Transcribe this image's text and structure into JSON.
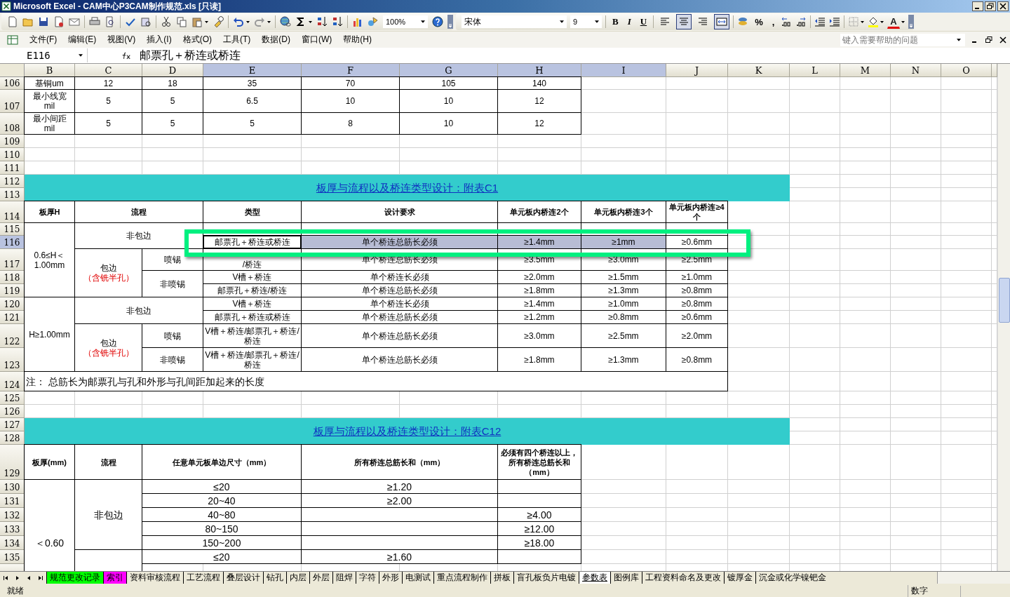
{
  "window": {
    "title": "Microsoft Excel - CAM中心P3CAM制作规范.xls [只读]"
  },
  "standard_toolbar": {
    "zoom": "100%"
  },
  "formatting_toolbar": {
    "font": "宋体",
    "size": "9",
    "styles": [
      {
        "label": "B",
        "on": false
      },
      {
        "label": "I",
        "on": false
      },
      {
        "label": "U",
        "on": false
      }
    ],
    "alignment": [
      {
        "pressed": false
      },
      {
        "pressed": true
      },
      {
        "pressed": false
      }
    ],
    "merge": true,
    "percent": "%",
    "comma": ",",
    "font_color": "A"
  },
  "menu": {
    "items": [
      "文件(F)",
      "编辑(E)",
      "视图(V)",
      "插入(I)",
      "格式(O)",
      "工具(T)",
      "数据(D)",
      "窗口(W)",
      "帮助(H)"
    ]
  },
  "help_box": {
    "placeholder": "键入需要帮助的问题"
  },
  "formula_bar": {
    "name_box": "E116",
    "formula": "邮票孔＋桥连或桥连"
  },
  "columns": [
    {
      "label": "B",
      "selected": false
    },
    {
      "label": "C",
      "selected": false
    },
    {
      "label": "D",
      "selected": false
    },
    {
      "label": "E",
      "selected": true
    },
    {
      "label": "F",
      "selected": true
    },
    {
      "label": "G",
      "selected": true
    },
    {
      "label": "H",
      "selected": true
    },
    {
      "label": "I",
      "selected": true
    },
    {
      "label": "J",
      "selected": false
    },
    {
      "label": "K",
      "selected": false
    },
    {
      "label": "L",
      "selected": false
    },
    {
      "label": "M",
      "selected": false
    },
    {
      "label": "N",
      "selected": false
    },
    {
      "label": "O",
      "selected": false
    }
  ],
  "rows": [
    {
      "label": "106",
      "selected": false
    },
    {
      "label": "107",
      "selected": false
    },
    {
      "label": "108",
      "selected": false
    },
    {
      "label": "109",
      "selected": false
    },
    {
      "label": "110",
      "selected": false
    },
    {
      "label": "111",
      "selected": false
    },
    {
      "label": "112",
      "selected": false
    },
    {
      "label": "113",
      "selected": false
    },
    {
      "label": "114",
      "selected": false
    },
    {
      "label": "115",
      "selected": false
    },
    {
      "label": "116",
      "selected": true
    },
    {
      "label": "117",
      "selected": false
    },
    {
      "label": "118",
      "selected": false
    },
    {
      "label": "119",
      "selected": false
    },
    {
      "label": "120",
      "selected": false
    },
    {
      "label": "121",
      "selected": false
    },
    {
      "label": "122",
      "selected": false
    },
    {
      "label": "123",
      "selected": false
    },
    {
      "label": "124",
      "selected": false
    },
    {
      "label": "125",
      "selected": false
    },
    {
      "label": "126",
      "selected": false
    },
    {
      "label": "127",
      "selected": false
    },
    {
      "label": "128",
      "selected": false
    },
    {
      "label": "129",
      "selected": false
    },
    {
      "label": "130",
      "selected": false
    },
    {
      "label": "131",
      "selected": false
    },
    {
      "label": "132",
      "selected": false
    },
    {
      "label": "133",
      "selected": false
    },
    {
      "label": "134",
      "selected": false
    },
    {
      "label": "135",
      "selected": false
    }
  ],
  "table_a": {
    "rows": [
      [
        "基铜um",
        "12",
        "18",
        "35",
        "70",
        "105",
        "140"
      ],
      [
        "最小线宽\nmil",
        "5",
        "5",
        "6.5",
        "10",
        "10",
        "12"
      ],
      [
        "最小间距\nmil",
        "5",
        "5",
        "5",
        "8",
        "10",
        "12"
      ]
    ]
  },
  "band_c1": {
    "title": "板厚与流程以及桥连类型设计：附表C1"
  },
  "table_c1": {
    "header": [
      "板厚H",
      "流程",
      "类型",
      "设计要求",
      "单元板内桥连2个",
      "单元板内桥连3个",
      "单元板内桥连≥4个"
    ],
    "cells": [
      {
        "text": "0.6≤H＜1.00mm"
      },
      {
        "text": "非包边"
      },
      {
        "text": "邮票孔＋桥连或桥连"
      },
      {
        "text": "单个桥连总筋长必须"
      },
      {
        "text": "≥1.4mm"
      },
      {
        "text": "≥1mm"
      },
      {
        "text": "≥0.6mm"
      },
      {
        "text": "包边",
        "note": "（含铣半孔）"
      },
      {
        "text": "喷锡"
      },
      {
        "text": "/桥连"
      },
      {
        "text": "单个桥连总筋长必须"
      },
      {
        "text": "≥3.5mm"
      },
      {
        "text": "≥3.0mm"
      },
      {
        "text": "≥2.5mm"
      },
      {
        "text": "非喷锡"
      },
      {
        "text": "V槽＋桥连"
      },
      {
        "text": "单个桥连长必须"
      },
      {
        "text": "≥2.0mm"
      },
      {
        "text": "≥1.5mm"
      },
      {
        "text": "≥1.0mm"
      },
      {
        "text": "邮票孔＋桥连/桥连"
      },
      {
        "text": "单个桥连总筋长必须"
      },
      {
        "text": "≥1.8mm"
      },
      {
        "text": "≥1.3mm"
      },
      {
        "text": "≥0.8mm"
      },
      {
        "text": "H≥1.00mm"
      },
      {
        "text": "非包边"
      },
      {
        "text": "V槽＋桥连"
      },
      {
        "text": "单个桥连长必须"
      },
      {
        "text": "≥1.4mm"
      },
      {
        "text": "≥1.0mm"
      },
      {
        "text": "≥0.8mm"
      },
      {
        "text": "邮票孔＋桥连或桥连"
      },
      {
        "text": "单个桥连总筋长必须"
      },
      {
        "text": "≥1.2mm"
      },
      {
        "text": "≥0.8mm"
      },
      {
        "text": "≥0.6mm"
      },
      {
        "text": "包边",
        "note": "（含铣半孔）"
      },
      {
        "text": "喷锡"
      },
      {
        "text": "V槽＋桥连/邮票孔＋桥连/桥连"
      },
      {
        "text": "单个桥连总筋长必须"
      },
      {
        "text": "≥3.0mm"
      },
      {
        "text": "≥2.5mm"
      },
      {
        "text": "≥2.0mm"
      },
      {
        "text": "非喷锡"
      },
      {
        "text": "V槽＋桥连/邮票孔＋桥连/桥连"
      },
      {
        "text": "单个桥连总筋长必须"
      },
      {
        "text": "≥1.8mm"
      },
      {
        "text": "≥1.3mm"
      },
      {
        "text": "≥0.8mm"
      }
    ]
  },
  "note": "注：  总筋长为邮票孔与孔和外形与孔间距加起来的长度",
  "band_c12": {
    "title": "板厚与流程以及桥连类型设计：附表C12"
  },
  "table_c12": {
    "header": [
      "板厚(mm)",
      "流程",
      "任意单元板单边尺寸（mm）",
      "所有桥连总筋长和（mm）",
      "必须有四个桥连以上，所有桥连总筋长和（mm）"
    ],
    "thickness": "＜0.60",
    "groups": [
      {
        "flow": "非包边",
        "rows": [
          {
            "size": "≤20",
            "total": "≥1.20"
          },
          {
            "size": "20~40",
            "total": "≥2.00"
          },
          {
            "size": "40~80",
            "four_plus": "≥4.00"
          },
          {
            "size": "80~150",
            "four_plus": "≥12.00"
          },
          {
            "size": "150~200",
            "four_plus": "≥18.00"
          }
        ]
      },
      {
        "rows": [
          {
            "size": "≤20",
            "total": "≥1.60"
          }
        ]
      }
    ]
  },
  "sheet_tabs": [
    {
      "label": "规范更改记录",
      "selected": false,
      "color": "#00ff00"
    },
    {
      "label": "索引",
      "selected": false,
      "color": "#ff00ff"
    },
    {
      "label": "资料审核流程",
      "selected": false
    },
    {
      "label": "工艺流程",
      "selected": false
    },
    {
      "label": "叠层设计",
      "selected": false
    },
    {
      "label": "钻孔",
      "selected": false
    },
    {
      "label": "内层",
      "selected": false
    },
    {
      "label": "外层",
      "selected": false
    },
    {
      "label": "阻焊",
      "selected": false
    },
    {
      "label": "字符",
      "selected": false
    },
    {
      "label": "外形",
      "selected": false
    },
    {
      "label": "电测试",
      "selected": false
    },
    {
      "label": "重点流程制作",
      "selected": false
    },
    {
      "label": "拼板",
      "selected": false
    },
    {
      "label": "盲孔板负片电镀",
      "selected": false
    },
    {
      "label": "参数表",
      "selected": true
    },
    {
      "label": "图例库",
      "selected": false
    },
    {
      "label": "工程资料命名及更改",
      "selected": false
    },
    {
      "label": "镀厚金",
      "selected": false
    },
    {
      "label": "沉金或化学镍钯金",
      "selected": false
    }
  ],
  "status_bar": {
    "left": "就绪",
    "right": "数字"
  }
}
